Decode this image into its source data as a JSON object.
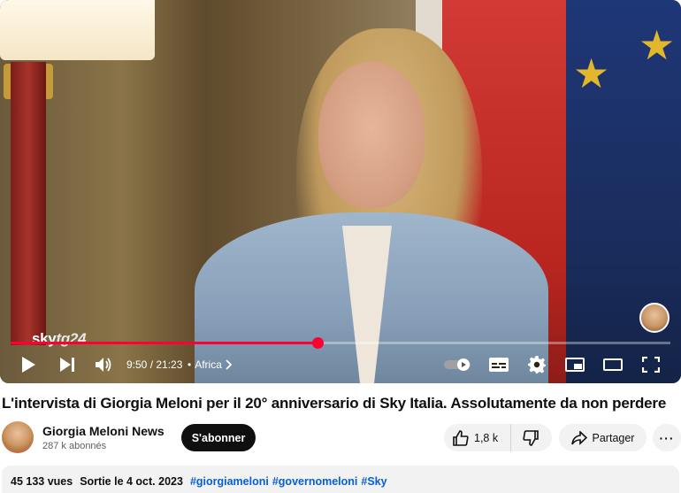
{
  "player": {
    "watermark_brand": "sky",
    "watermark_channel": "tg24",
    "progress": {
      "played_fraction": 0.4655,
      "loaded_fraction": 0.47
    },
    "current_time": "9:50",
    "duration": "21:23",
    "time_display": "9:50 / 21:23",
    "chapter": "Africa",
    "icons": [
      "play-icon",
      "next-icon",
      "volume-icon",
      "autoplay-toggle-icon",
      "subtitles-icon",
      "settings-icon",
      "miniplayer-icon",
      "theater-mode-icon",
      "fullscreen-icon"
    ]
  },
  "video": {
    "title": "L'intervista di Giorgia Meloni per il 20° anniversario di Sky Italia. Assolutamente da non perdere"
  },
  "channel": {
    "name": "Giorgia Meloni News",
    "subscribers": "287 k abonnés",
    "subscribe_label": "S'abonner"
  },
  "actions": {
    "like_count": "1,8 k",
    "share_label": "Partager",
    "more_label": "···"
  },
  "description": {
    "views": "45 133 vues",
    "date": "Sortie le 4 oct. 2023",
    "hashtags": [
      "#giorgiameloni",
      "#governomeloni",
      "#Sky"
    ]
  },
  "colors": {
    "accent": "#ff0033",
    "link": "#065fd4",
    "pill_bg": "#f2f2f2",
    "text": "#0f0f0f"
  }
}
